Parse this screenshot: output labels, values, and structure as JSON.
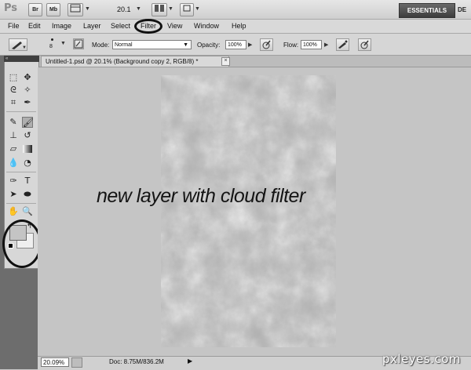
{
  "app": {
    "logo": "Ps",
    "bridge_label": "Br",
    "minibridge_label": "Mb",
    "zoom_display": "20.1",
    "workspace_label": "ESSENTIALS",
    "workspace_next": "DE"
  },
  "menu": [
    "File",
    "Edit",
    "Image",
    "Layer",
    "Select",
    "Filter",
    "View",
    "Window",
    "Help"
  ],
  "options": {
    "brush_size": "8",
    "mode_label": "Mode:",
    "mode_value": "Normal",
    "opacity_label": "Opacity:",
    "opacity_value": "100%",
    "flow_label": "Flow:",
    "flow_value": "100%"
  },
  "document": {
    "tab_title": "Untitled-1.psd @ 20.1% (Background copy 2, RGB/8) *",
    "close": "×",
    "caption": "new layer with cloud filter"
  },
  "status": {
    "zoom": "20.09%",
    "doc_info": "Doc: 8.75M/836.2M"
  },
  "colors": {
    "foreground": "#c4c4c4",
    "background": "#efefef",
    "annotation": "#111111"
  },
  "watermark": "pxleyes.com"
}
